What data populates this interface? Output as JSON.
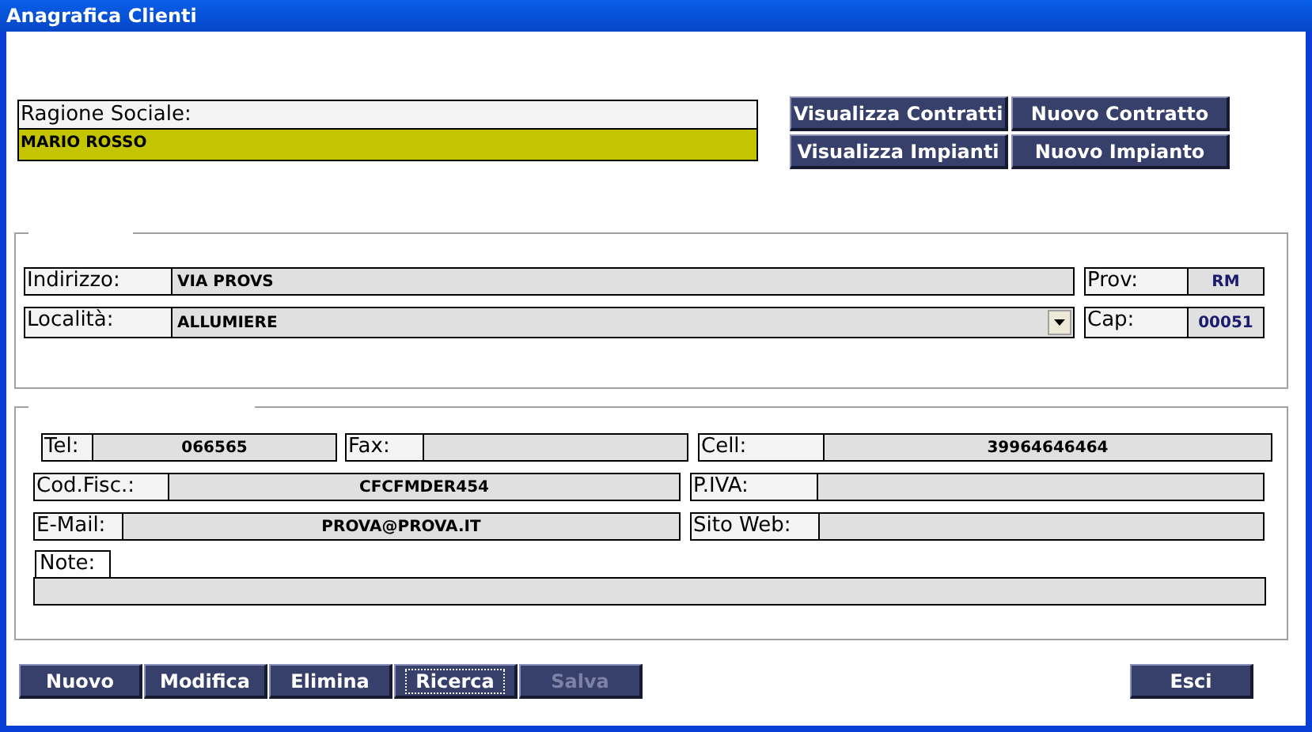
{
  "window": {
    "title": "Anagrafica Clienti"
  },
  "ragione_sociale": {
    "label": "Ragione Sociale:",
    "value": "MARIO ROSSO"
  },
  "actions": [
    {
      "label": "Visualizza Contratti"
    },
    {
      "label": "Nuovo Contratto"
    },
    {
      "label": "Visualizza Impianti"
    },
    {
      "label": "Nuovo Impianto"
    }
  ],
  "address_rows": [
    [
      {
        "label": "Indirizzo:",
        "value": "VIA PROVS",
        "kind": "text"
      },
      {
        "label": "Prov:",
        "value": "RM",
        "kind": "text"
      }
    ],
    [
      {
        "label": "Località:",
        "value": "ALLUMIERE",
        "kind": "combo"
      },
      {
        "label": "Cap:",
        "value": "00051",
        "kind": "text"
      }
    ]
  ],
  "contact_rows": [
    [
      {
        "label": "Tel:",
        "value": "066565"
      },
      {
        "label": "Fax:"
      },
      {
        "label": "Cell:",
        "value": "39964646464"
      }
    ],
    [
      {
        "label": "Cod.Fisc.:",
        "value": "CFCFMDER454"
      },
      {
        "label": "P.IVA:"
      }
    ],
    [
      {
        "label": "E-Mail:",
        "value": "PROVA@PROVA.IT"
      },
      {
        "label": "Sito Web:"
      }
    ]
  ],
  "note": {
    "label": "Note:"
  },
  "toolbar": [
    {
      "label": "Nuovo",
      "disabled": false,
      "focused": false
    },
    {
      "label": "Modifica",
      "disabled": false,
      "focused": false
    },
    {
      "label": "Elimina",
      "disabled": false,
      "focused": false
    },
    {
      "label": "Ricerca",
      "disabled": false,
      "focused": true
    },
    {
      "label": "Salva",
      "disabled": true,
      "focused": false
    }
  ],
  "exit_button": {
    "label": "Esci"
  }
}
